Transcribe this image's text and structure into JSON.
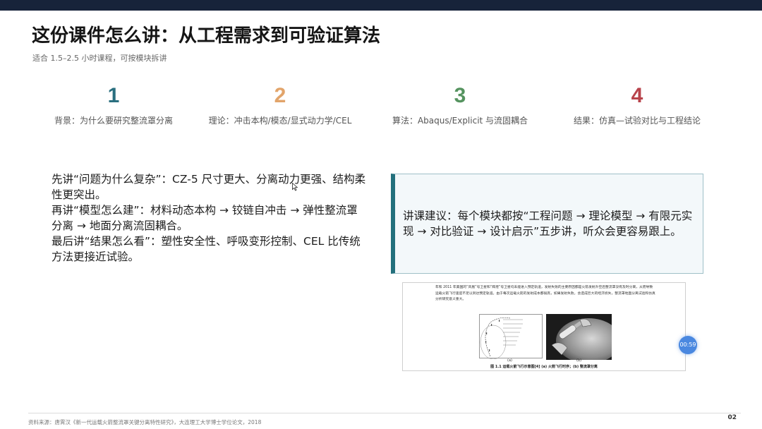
{
  "slide": {
    "title": "这份课件怎么讲：从工程需求到可验证算法",
    "subtitle": "适合 1.5–2.5 小时课程，可按模块拆讲",
    "steps": [
      {
        "num": "1",
        "label": "背景：为什么要研究整流罩分离",
        "color": "#2a6f7f"
      },
      {
        "num": "2",
        "label": "理论：冲击本构/模态/显式动力学/CEL",
        "color": "#e2a46a"
      },
      {
        "num": "3",
        "label": "算法：Abaqus/Explicit 与流固耦合",
        "color": "#55935f"
      },
      {
        "num": "4",
        "label": "结果：仿真—试验对比与工程结论",
        "color": "#b8434b"
      }
    ],
    "body": [
      "先讲“问题为什么复杂”：CZ-5 尺寸更大、分离动力更强、结构柔性更突出。",
      "再讲“模型怎么建”：材料动态本构 → 铰链自冲击 → 弹性整流罩分离 → 地面分离流固耦合。",
      "最后讲“结果怎么看”：塑性安全性、呼吸变形控制、CEL 比传统方法更接近试验。"
    ],
    "callout": "讲课建议：每个模块都按“工程问题 → 理论模型 → 有限元实现 → 对比验证 → 设计启示”五步讲，听众会更容易跟上。",
    "figure": {
      "text": "年和 2011 年美国的“凤凰”号卫星和“辉煌”号卫星均未能进入预定轨道，发射失败的主要原因都是火箭发射升空后整流罩没有及时分离，从而导致运载火箭飞行速度不足以到达预定轨道。由于每次运载火箭的发射成本都很高，如果发射失败，会造成巨大的经济损失，整流罩地面分离试验和仿真分析研究意义重大。",
      "sub_a": "(a)",
      "sub_b": "(b)",
      "caption": "图 1.1 运载火箭飞行示意图[4]  (a) 火箭飞行时序；(b) 整流罩分离"
    },
    "timer": "00:59",
    "footnote": "资料来源：唐霄汉《新一代运载火箭整流罩关键分离特性研究》，大连理工大学博士学位论文，2018",
    "page_number": "02"
  }
}
